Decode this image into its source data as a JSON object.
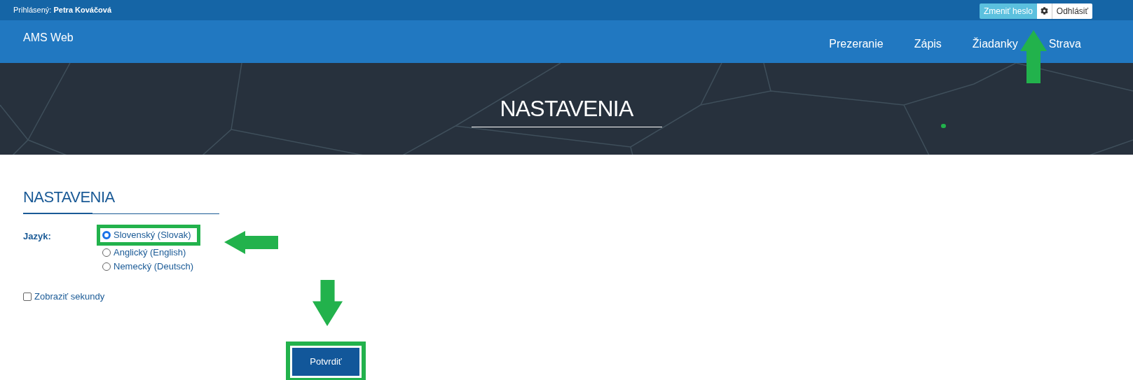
{
  "top_bar": {
    "logged_in_label": "Prihlásený:",
    "user_name": "Petra Kováčová",
    "buttons": [
      {
        "kind": "primary",
        "label": "Zmeniť heslo"
      },
      {
        "kind": "settings"
      },
      {
        "kind": "default",
        "label": "Odhlásiť"
      }
    ]
  },
  "navbar": {
    "brand": "AMS Web",
    "items": [
      "Prezeranie",
      "Zápis",
      "Žiadanky",
      "Strava"
    ]
  },
  "banner": {
    "title": "NASTAVENIA"
  },
  "settings": {
    "heading": "NASTAVENIA",
    "language_label": "Jazyk:",
    "languages": [
      {
        "label": "Slovenský (Slovak)",
        "selected": true
      },
      {
        "label": "Anglický (English)",
        "selected": false
      },
      {
        "label": "Nemecký (Deutsch)",
        "selected": false
      }
    ],
    "show_seconds": {
      "label": "Zobraziť sekundy",
      "checked": false
    },
    "submit": "Potvrdiť"
  }
}
